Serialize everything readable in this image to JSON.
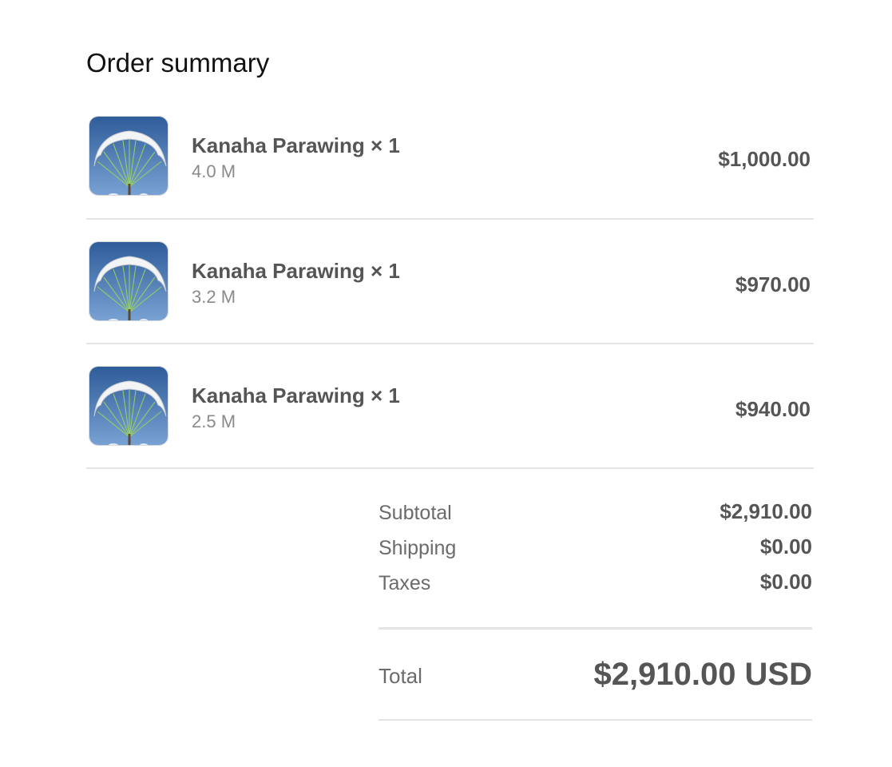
{
  "heading": "Order summary",
  "items": [
    {
      "title": "Kanaha Parawing × 1",
      "variant": "4.0 M",
      "price": "$1,000.00",
      "image": "parawing-thumbnail"
    },
    {
      "title": "Kanaha Parawing × 1",
      "variant": "3.2 M",
      "price": "$970.00",
      "image": "parawing-thumbnail"
    },
    {
      "title": "Kanaha Parawing × 1",
      "variant": "2.5 M",
      "price": "$940.00",
      "image": "parawing-thumbnail"
    }
  ],
  "totals": {
    "subtotal_label": "Subtotal",
    "subtotal_value": "$2,910.00",
    "shipping_label": "Shipping",
    "shipping_value": "$0.00",
    "taxes_label": "Taxes",
    "taxes_value": "$0.00",
    "total_label": "Total",
    "total_value": "$2,910.00 USD"
  },
  "colors": {
    "text_primary": "#111111",
    "text_strong": "#555555",
    "text_muted": "#8a8a8a",
    "divider": "#e4e4e4",
    "sky_top": "#2f5d9a",
    "sky_bottom": "#6f9bd0"
  }
}
